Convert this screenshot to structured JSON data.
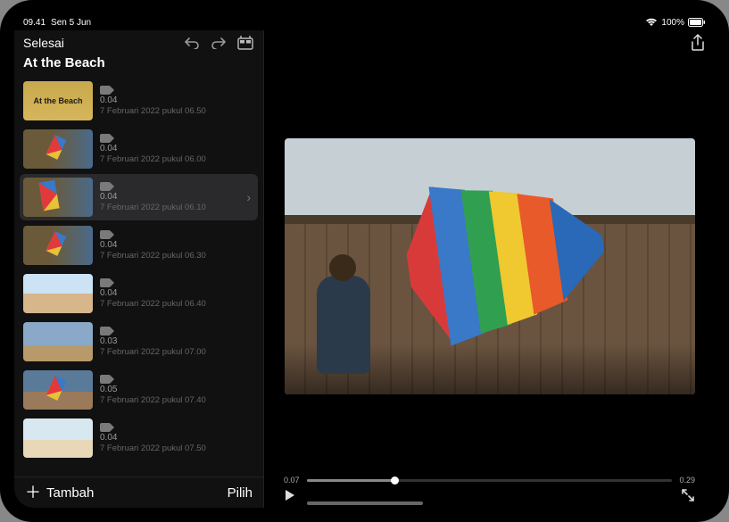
{
  "status": {
    "time": "09.41",
    "date": "Sen 5 Jun",
    "battery_pct": "100%"
  },
  "sidebar": {
    "done_label": "Selesai",
    "project_title": "At the Beach",
    "add_label": "Tambah",
    "select_label": "Pilih",
    "clips": [
      {
        "thumb_text": "At the Beach",
        "duration": "0.04",
        "date": "7 Februari 2022 pukul 06.50",
        "selected": false
      },
      {
        "thumb_text": "",
        "duration": "0.04",
        "date": "7 Februari 2022 pukul 06.00",
        "selected": false
      },
      {
        "thumb_text": "",
        "duration": "0.04",
        "date": "7 Februari 2022 pukul 06.10",
        "selected": true
      },
      {
        "thumb_text": "",
        "duration": "0.04",
        "date": "7 Februari 2022 pukul 06.30",
        "selected": false
      },
      {
        "thumb_text": "",
        "duration": "0.04",
        "date": "7 Februari 2022 pukul 06.40",
        "selected": false
      },
      {
        "thumb_text": "",
        "duration": "0.03",
        "date": "7 Februari 2022 pukul 07.00",
        "selected": false
      },
      {
        "thumb_text": "",
        "duration": "0.05",
        "date": "7 Februari 2022 pukul 07.40",
        "selected": false
      },
      {
        "thumb_text": "",
        "duration": "0.04",
        "date": "7 Februari 2022 pukul 07.50",
        "selected": false
      }
    ]
  },
  "viewer": {
    "time_current": "0.07",
    "time_total": "0.29"
  }
}
